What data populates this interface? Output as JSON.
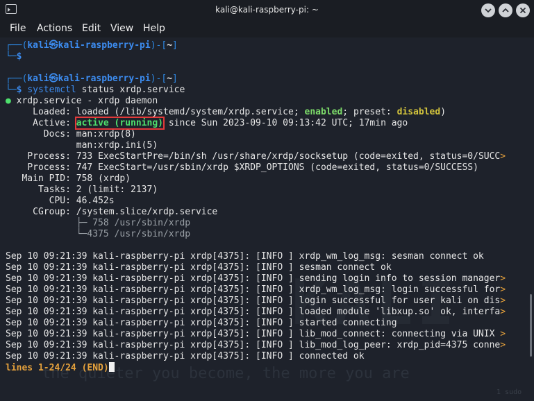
{
  "window": {
    "title": "kali@kali-raspberry-pi: ~"
  },
  "menu": {
    "file": "File",
    "actions": "Actions",
    "edit": "Edit",
    "view": "View",
    "help": "Help"
  },
  "prompt": {
    "user": "kali",
    "at": "㉿",
    "host": "kali-raspberry-pi",
    "dir": "~",
    "dollar": "$"
  },
  "command": {
    "name": "systemctl",
    "args": "status xrdp.service"
  },
  "status": {
    "unit": "xrdp.service - xrdp daemon",
    "loaded_label": "Loaded:",
    "loaded_pre": "loaded (/lib/systemd/system/xrdp.service;",
    "enabled": "enabled",
    "preset_label": "; preset:",
    "preset_value": "disabled",
    "active_label": "Active:",
    "active_state": "active (running)",
    "active_since": " since Sun 2023-09-10 09:13:42 UTC; 17min ago",
    "docs_label": "Docs:",
    "docs_1": "man:xrdp(8)",
    "docs_2": "man:xrdp.ini(5)",
    "process_label": "Process:",
    "process_1": "733 ExecStartPre=/bin/sh /usr/share/xrdp/socksetup (code=exited, status=0/SUCC",
    "process_2": "747 ExecStart=/usr/sbin/xrdp $XRDP_OPTIONS (code=exited, status=0/SUCCESS)",
    "mainpid_label": "Main PID:",
    "mainpid": "758 (xrdp)",
    "tasks_label": "Tasks:",
    "tasks": "2 (limit: 2137)",
    "cpu_label": "CPU:",
    "cpu": "46.452s",
    "cgroup_label": "CGroup:",
    "cgroup": "/system.slice/xrdp.service",
    "tree_1": "├─ 758 /usr/sbin/xrdp",
    "tree_2": "└─4375 /usr/sbin/xrdp",
    "overflow": ">"
  },
  "log": [
    {
      "prefix": "Sep 10 09:21:39 kali-raspberry-pi xrdp[4375]: [INFO ] ",
      "msg": "xrdp_wm_log_msg: sesman connect ok",
      "trunc": ""
    },
    {
      "prefix": "Sep 10 09:21:39 kali-raspberry-pi xrdp[4375]: [INFO ] ",
      "msg": "sesman connect ok",
      "trunc": ""
    },
    {
      "prefix": "Sep 10 09:21:39 kali-raspberry-pi xrdp[4375]: [INFO ] ",
      "msg": "sending login info to session manager",
      "trunc": ">"
    },
    {
      "prefix": "Sep 10 09:21:39 kali-raspberry-pi xrdp[4375]: [INFO ] ",
      "msg": "xrdp_wm_log_msg: login successful for",
      "trunc": ">"
    },
    {
      "prefix": "Sep 10 09:21:39 kali-raspberry-pi xrdp[4375]: [INFO ] ",
      "msg": "login successful for user kali on dis",
      "trunc": ">"
    },
    {
      "prefix": "Sep 10 09:21:39 kali-raspberry-pi xrdp[4375]: [INFO ] ",
      "msg": "loaded module 'libxup.so' ok, interfa",
      "trunc": ">"
    },
    {
      "prefix": "Sep 10 09:21:39 kali-raspberry-pi xrdp[4375]: [INFO ] ",
      "msg": "started connecting",
      "trunc": ""
    },
    {
      "prefix": "Sep 10 09:21:39 kali-raspberry-pi xrdp[4375]: [INFO ] ",
      "msg": "lib_mod_connect: connecting via UNIX ",
      "trunc": ">"
    },
    {
      "prefix": "Sep 10 09:21:39 kali-raspberry-pi xrdp[4375]: [INFO ] ",
      "msg": "lib_mod_log_peer: xrdp_pid=4375 conne",
      "trunc": ">"
    },
    {
      "prefix": "Sep 10 09:21:39 kali-raspberry-pi xrdp[4375]: [INFO ] ",
      "msg": "connected ok",
      "trunc": ""
    }
  ],
  "pager": "lines 1-24/24 (END)",
  "background": {
    "tagline": "the quieter you become, the more you are",
    "corner": "1 sudo"
  }
}
